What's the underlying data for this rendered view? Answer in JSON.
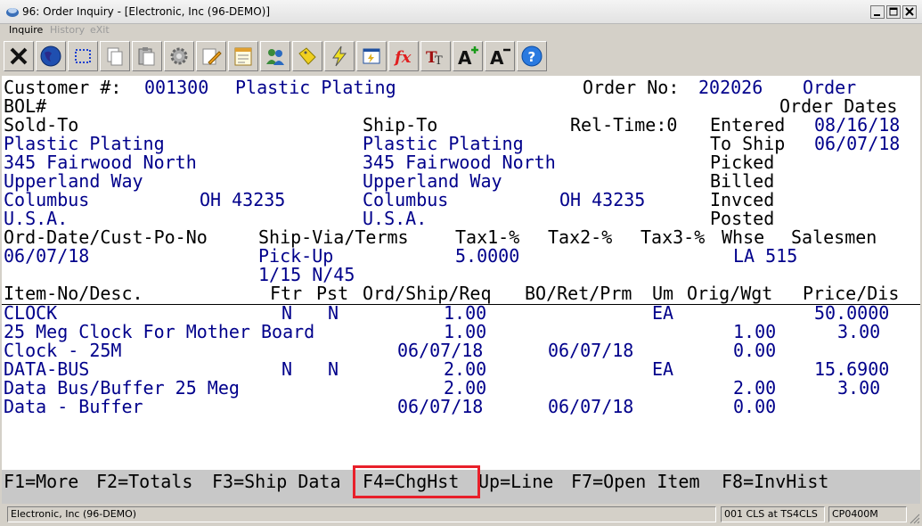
{
  "window": {
    "title": "96: Order Inquiry - [Electronic, Inc (96-DEMO)]"
  },
  "menu": {
    "items": [
      {
        "label": "Inquire",
        "enabled": true
      },
      {
        "label": "History",
        "enabled": false
      },
      {
        "label": "eXit",
        "enabled": false
      }
    ]
  },
  "toolbar": {
    "buttons": [
      "close-x-icon",
      "globe-icon",
      "select-box-icon",
      "copy-icon",
      "paste-icon",
      "settings-gear-icon",
      "edit-pencil-icon",
      "notepad-icon",
      "users-icon",
      "tag-icon",
      "lightning-icon",
      "form-icon",
      "function-fx-icon",
      "font-tt-icon",
      "font-increase-icon",
      "font-decrease-icon",
      "help-icon"
    ]
  },
  "header": {
    "customer_label": "Customer #:",
    "customer_no": "001300",
    "customer_name": "Plastic Plating",
    "order_label": "Order No:",
    "order_no": "202026",
    "order_type": "Order",
    "bol_label": "BOL#",
    "order_dates_label": "Order Dates",
    "sold_to_label": "Sold-To",
    "ship_to_label": "Ship-To",
    "rel_time_label": "Rel-Time:0"
  },
  "sold_to": {
    "name": "Plastic Plating",
    "address1": "345 Fairwood North",
    "address2": "Upperland Way",
    "city": "Columbus",
    "state_zip": "OH 43235",
    "country": "U.S.A."
  },
  "ship_to": {
    "name": "Plastic Plating",
    "address1": "345 Fairwood North",
    "address2": "Upperland Way",
    "city": "Columbus",
    "state_zip": "OH 43235",
    "country": "U.S.A."
  },
  "dates": {
    "entered_label": "Entered",
    "entered": "08/16/18",
    "to_ship_label": "To Ship",
    "to_ship": "06/07/18",
    "picked_label": "Picked",
    "billed_label": "Billed",
    "invced_label": "Invced",
    "posted_label": "Posted"
  },
  "terms_header": {
    "ord_date_label": "Ord-Date/Cust-Po-No",
    "ship_via_label": "Ship-Via/Terms",
    "tax1_label": "Tax1-%",
    "tax2_label": "Tax2-%",
    "tax3_label": "Tax3-%",
    "whse_label": "Whse",
    "salesmen_label": "Salesmen",
    "ord_date": "06/07/18",
    "ship_via": "Pick-Up",
    "terms": "1/15 N/45",
    "tax1": "5.0000",
    "whse_salesmen": "LA 515"
  },
  "lines_header": {
    "item_label": "Item-No/Desc.",
    "ftr_label": "Ftr",
    "pst_label": "Pst",
    "ord_label": "Ord/Ship/Req",
    "bo_label": "BO/Ret/Prm",
    "um_label": "Um",
    "orig_label": "Orig/Wgt",
    "price_label": "Price/Dis"
  },
  "lines": [
    {
      "item": "CLOCK",
      "desc1": "25 Meg Clock For Mother Board",
      "desc2": "Clock - 25M",
      "ftr": "N",
      "pst": "N",
      "ord": "1.00",
      "ship": "1.00",
      "req": "06/07/18",
      "prm": "06/07/18",
      "um": "EA",
      "orig": "1.00",
      "wgt": "0.00",
      "price": "50.0000",
      "dis": "3.00"
    },
    {
      "item": "DATA-BUS",
      "desc1": "Data Bus/Buffer 25 Meg",
      "desc2": "Data - Buffer",
      "ftr": "N",
      "pst": "N",
      "ord": "2.00",
      "ship": "2.00",
      "req": "06/07/18",
      "prm": "06/07/18",
      "um": "EA",
      "orig": "2.00",
      "wgt": "0.00",
      "price": "15.6900",
      "dis": "3.00"
    }
  ],
  "fkeys": {
    "f1": "F1=More",
    "f2": "F2=Totals",
    "f3": "F3=Ship Data",
    "f4": "F4=ChgHst",
    "up": "Up=Line",
    "f7": "F7=Open Item",
    "f8": "F8=InvHist"
  },
  "status": {
    "company": "Electronic, Inc (96-DEMO)",
    "session": "001 CLS at TS4CLS",
    "program": "CP0400M"
  },
  "colors": {
    "label": "#000000",
    "value": "#00008b",
    "highlight": "#e8202a"
  }
}
